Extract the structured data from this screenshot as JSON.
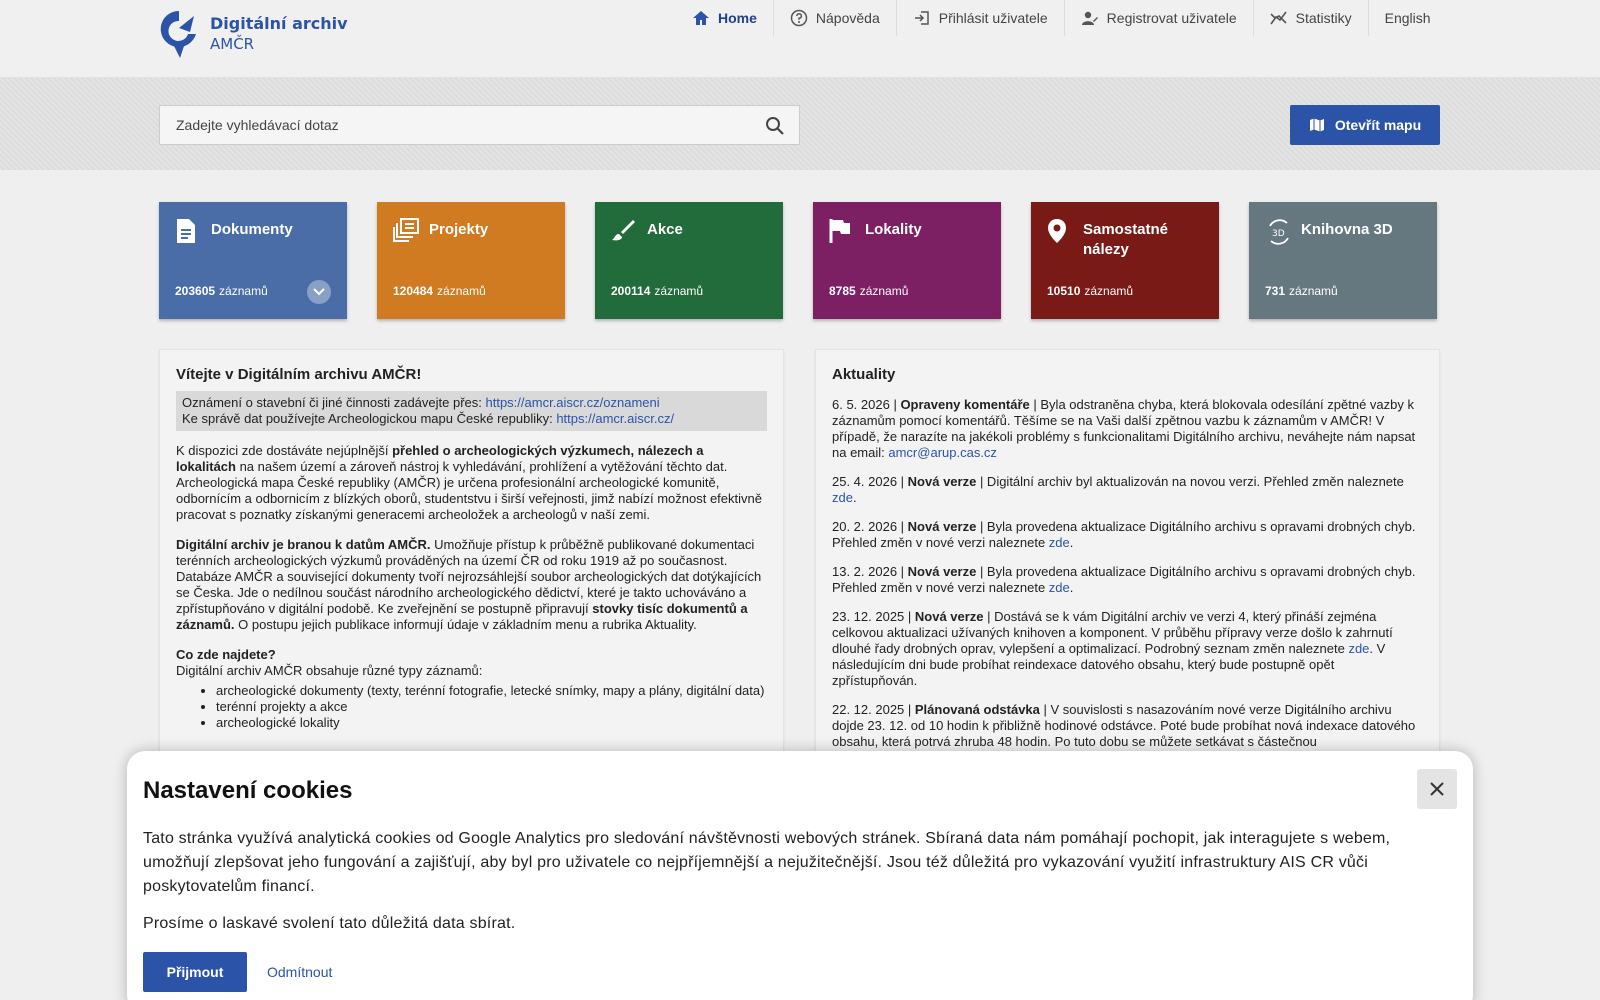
{
  "logo": {
    "line1": "Digitální archiv",
    "line2": "AMČR"
  },
  "nav": [
    {
      "label": "Home",
      "icon": "home-icon"
    },
    {
      "label": "Nápověda",
      "icon": "help-icon"
    },
    {
      "label": "Přihlásit uživatele",
      "icon": "login-icon"
    },
    {
      "label": "Registrovat uživatele",
      "icon": "register-icon"
    },
    {
      "label": "Statistiky",
      "icon": "stats-icon"
    },
    {
      "label": "English"
    }
  ],
  "search": {
    "placeholder": "Zadejte vyhledávací dotaz"
  },
  "map_button": {
    "label": "Otevřít mapu"
  },
  "tiles": [
    {
      "title": "Dokumenty",
      "count": "203605",
      "unit": "záznamů",
      "color": "#4a6da7"
    },
    {
      "title": "Projekty",
      "count": "120484",
      "unit": "záznamů",
      "color": "#d07a22"
    },
    {
      "title": "Akce",
      "count": "200114",
      "unit": "záznamů",
      "color": "#226b3a"
    },
    {
      "title": "Lokality",
      "count": "8785",
      "unit": "záznamů",
      "color": "#7d1f63"
    },
    {
      "title": "Samostatné nálezy",
      "count": "10510",
      "unit": "záznamů",
      "color": "#7a1a17"
    },
    {
      "title": "Knihovna 3D",
      "count": "731",
      "unit": "záznamů",
      "color": "#66787f"
    }
  ],
  "welcome": {
    "title": "Vítejte v Digitálním archivu AMČR!",
    "notice1_text": "Oznámení o stavební či jiné činnosti zadávejte přes: ",
    "notice1_link": "https://amcr.aiscr.cz/oznameni",
    "notice2_text": "Ke správě dat používejte Archeologickou mapu České republiky: ",
    "notice2_link": "https://amcr.aiscr.cz/",
    "p1_a": "K dispozici zde dostáváte nejúplnější ",
    "p1_b": "přehled o archeologických výzkumech, nálezech a lokalitách",
    "p1_c": " na našem území a zároveň nástroj k vyhledávání, prohlížení a vytěžování těchto dat. Archeologická mapa České republiky (AMČR) je určena profesionální archeologické komunitě, odbornícím a odbornicím z blízkých oborů, studentstvu i širší veřejnosti, jimž nabízí možnost efektivně pracovat s poznatky získanými generacemi archeoložek a archeologů v naší zemi.",
    "p2_a": "Digitální archiv je branou k datům AMČR.",
    "p2_b": " Umožňuje přístup k průběžně publikované dokumentaci terénních archeologických výzkumů prováděných na území ČR od roku 1919 až po současnost. Databáze AMČR a související dokumenty tvoří nejrozsáhlejší soubor archeologických dat dotýkajících se Česka. Jde o nedílnou součást národního archeologického dědictví, které je takto uchováváno a zpřístupňováno v digitální podobě. Ke zveřejnění se postupně připravují ",
    "p2_c": "stovky tisíc dokumentů a záznamů.",
    "p2_d": " O postupu jejich publikace informují údaje v základním menu a rubrika Aktuality.",
    "sub_title": "Co zde najdete?",
    "sub_text": "Digitální archiv AMČR obsahuje různé typy záznamů:",
    "list": [
      "archeologické dokumenty (texty, terénní fotografie, letecké snímky, mapy a plány, digitální data)",
      "terénní projekty a akce",
      "archeologické lokality"
    ]
  },
  "news": {
    "title": "Aktuality",
    "items": [
      {
        "date": "6. 5. 2026 | ",
        "head": "Opraveny komentáře",
        "text": " | Byla odstraněna chyba, která blokovala odesílání zpětné vazby k záznamům pomocí komentářů. Těšíme se na Vaši další zpětnou vazbu k záznamům v AMČR! V případě, že narazíte na jakékoli problémy s funkcionalitami Digitálního archivu, neváhejte nám napsat na email: ",
        "link": "amcr@arup.cas.cz",
        "after": ""
      },
      {
        "date": "25. 4. 2026 | ",
        "head": "Nová verze",
        "text": " | Digitální archiv byl aktualizován na novou verzi. Přehled změn naleznete ",
        "link": "zde",
        "after": "."
      },
      {
        "date": "20. 2. 2026 | ",
        "head": "Nová verze",
        "text": " | Byla provedena aktualizace Digitálního archivu s opravami drobných chyb. Přehled změn v nové verzi naleznete ",
        "link": "zde",
        "after": "."
      },
      {
        "date": "13. 2. 2026 | ",
        "head": "Nová verze",
        "text": " | Byla provedena aktualizace Digitálního archivu s opravami drobných chyb. Přehled změn v nové verzi naleznete ",
        "link": "zde",
        "after": "."
      },
      {
        "date": "23. 12. 2025 | ",
        "head": "Nová verze",
        "text": " | Dostává se k vám Digitální archiv ve verzi 4, který přináší zejména celkovou aktualizaci užívaných knihoven a komponent. V průběhu přípravy verze došlo k zahrnutí dlouhé řady drobných oprav, vylepšení a optimalizací. Podrobný seznam změn naleznete ",
        "link": "zde",
        "after": ". V následujícím dni bude probíhat reindexace datového obsahu, který bude postupně opět zpřístupňován."
      },
      {
        "date": "22. 12. 2025 | ",
        "head": "Plánovaná odstávka",
        "text": " | V souvislosti s nasazováním nové verze Digitálního archivu dojde 23. 12. od 10 hodin k přibližně hodinové odstávce. Poté bude probíhat nová indexace datového obsahu, která potrvá zhruba 48 hodin. Po tuto dobu se můžete setkávat s částečnou",
        "link": "",
        "after": ""
      }
    ]
  },
  "cookie": {
    "title": "Nastavení cookies",
    "text": "Tato stránka využívá analytická cookies od Google Analytics pro sledování návštěvnosti webových stránek. Sbíraná data nám pomáhají pochopit, jak interagujete s webem, umožňují zlepšovat jeho fungování a zajišťují, aby byl pro uživatele co nejpříjemnější a nejužitečnější. Jsou též důležitá pro vykazování využití infrastruktury AIS CR vůči poskytovatelům financí.",
    "ask": "Prosíme o laskavé svolení tato důležitá data sbírat.",
    "accept": "Přijmout",
    "decline": "Odmítnout"
  }
}
